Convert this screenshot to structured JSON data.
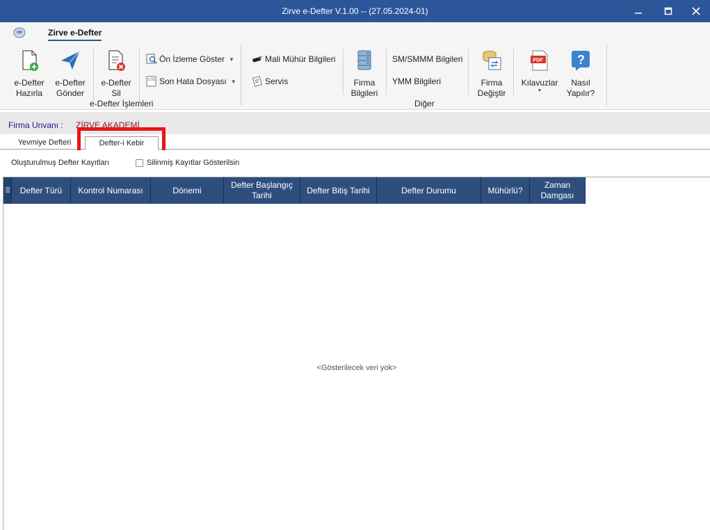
{
  "window": {
    "title": "Zirve e-Defter V.1.00  -- (27.05.2024-01)"
  },
  "ribbon": {
    "tab_label": "Zirve e-Defter",
    "buttons": {
      "hazirla": "e-Defter Hazırla",
      "gonder": "e-Defter Gönder",
      "sil": "e-Defter Sil",
      "on_izleme": "Ön İzleme Göster",
      "son_hata": "Son Hata Dosyası",
      "mali_muhur": "Mali Mühür Bilgileri",
      "servis": "Servis",
      "firma_bilgileri": "Firma Bilgileri",
      "sm_smmm": "SM/SMMM Bilgileri",
      "ymm": "YMM Bilgileri",
      "firma_degistir": "Firma Değiştir",
      "kilavuzlar": "Kılavuzlar",
      "nasil_yapilir": "Nasıl Yapılır?"
    },
    "groups": {
      "edefter_islemleri": "e-Defter İşlemleri",
      "diger": "Diğer"
    },
    "pdf_badge": "PDF",
    "help_glyph": "?",
    "log_badge": "LOG"
  },
  "firma": {
    "label": "Firma Unvanı :",
    "value": "ZİRVE AKADEMİ"
  },
  "tabs": [
    {
      "label": "Yevmiye Defteri",
      "active": false
    },
    {
      "label": "Defter-i Kebir",
      "active": true
    }
  ],
  "options": {
    "records_label": "Oluşturulmuş Defter Kayıtları",
    "show_deleted_label": "Silinmiş Kayıtlar Gösterilsin",
    "show_deleted_checked": false
  },
  "grid": {
    "columns": [
      "Defter Türü",
      "Kontrol Numarası",
      "Dönemi",
      "Defter Başlangıç Tarihi",
      "Defter Bitiş Tarihi",
      "Defter Durumu",
      "Mühürlü?",
      "Zaman Damgası"
    ],
    "empty_text": "<Gösterilecek veri yok>"
  },
  "colors": {
    "titlebar": "#2b579a",
    "grid_header": "#2e4f7e",
    "highlight": "#e8131b",
    "firma_value": "#8b1a1a"
  }
}
